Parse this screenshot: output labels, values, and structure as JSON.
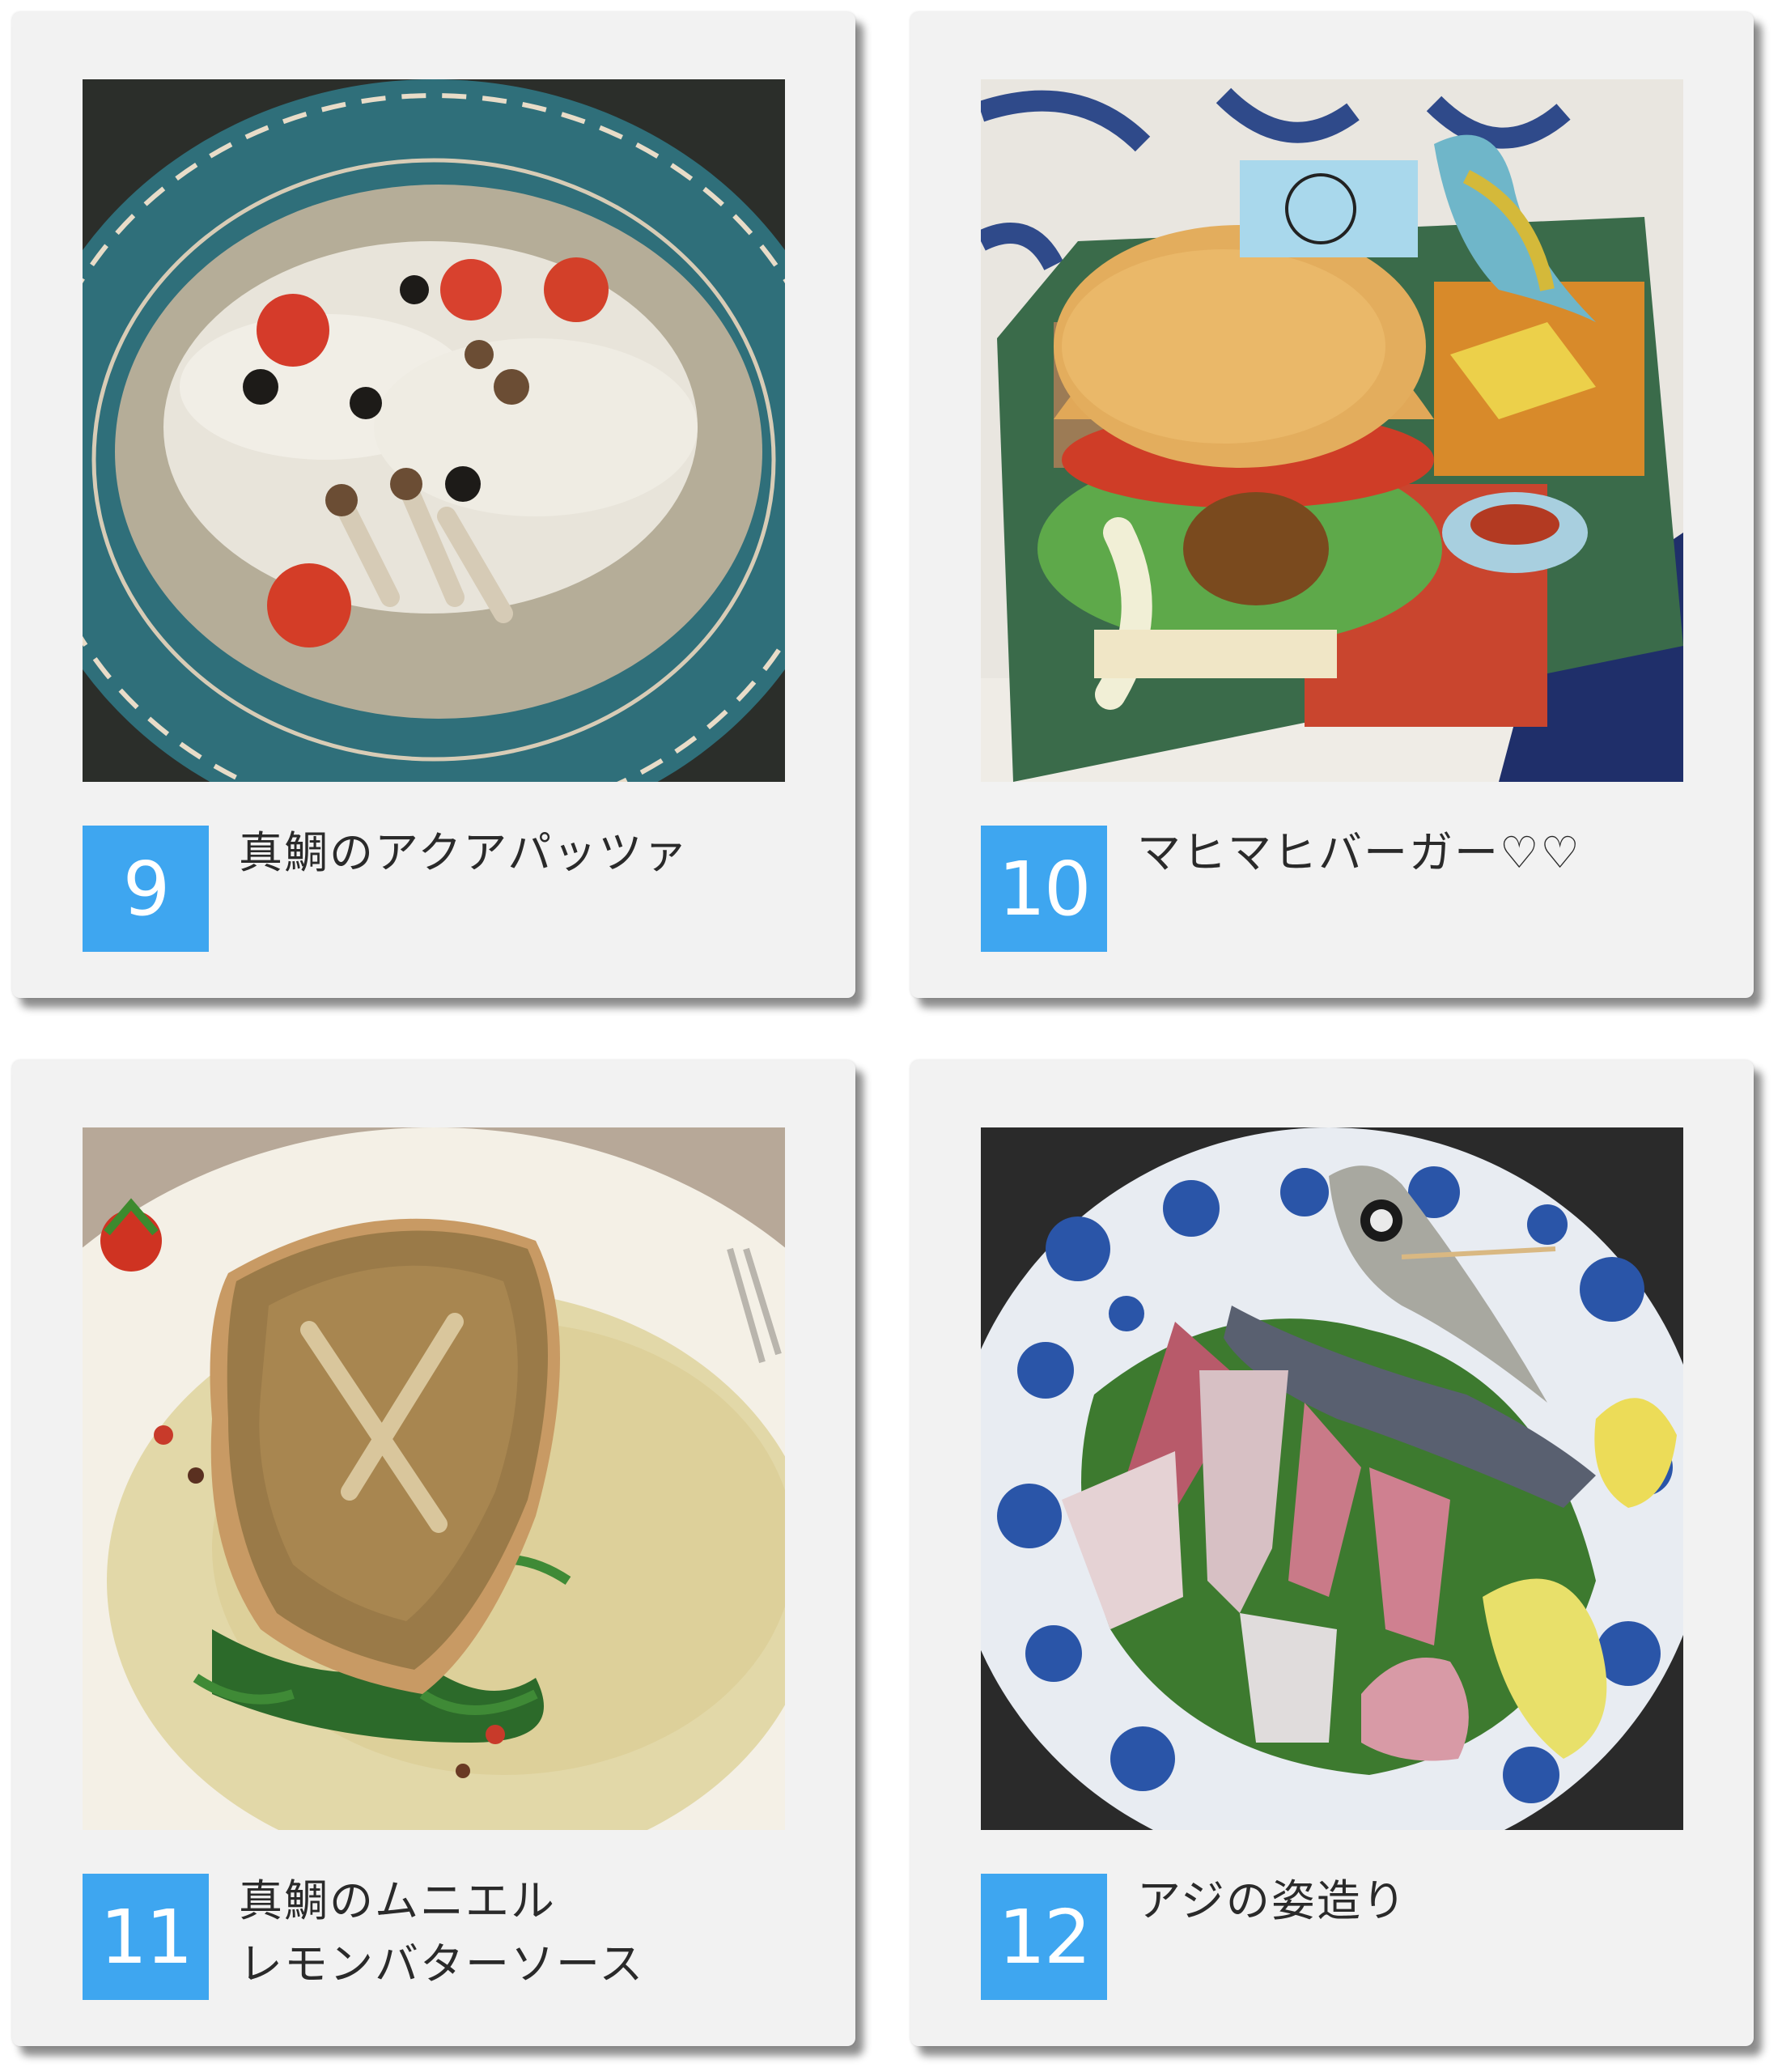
{
  "cards": [
    {
      "number": "9",
      "caption_line1": "真鯛のアクアパッツァ",
      "caption_line2": ""
    },
    {
      "number": "10",
      "caption_line1": "マヒマヒバーガー♡♡",
      "caption_line2": ""
    },
    {
      "number": "11",
      "caption_line1": "真鯛のムニエル",
      "caption_line2": "レモンバターソース"
    },
    {
      "number": "12",
      "caption_line1": "アジの姿造り",
      "caption_line2": ""
    }
  ],
  "colors": {
    "card_background": "#f2f2f2",
    "number_badge": "#3ea6f0",
    "caption_text": "#2a2a2a"
  }
}
